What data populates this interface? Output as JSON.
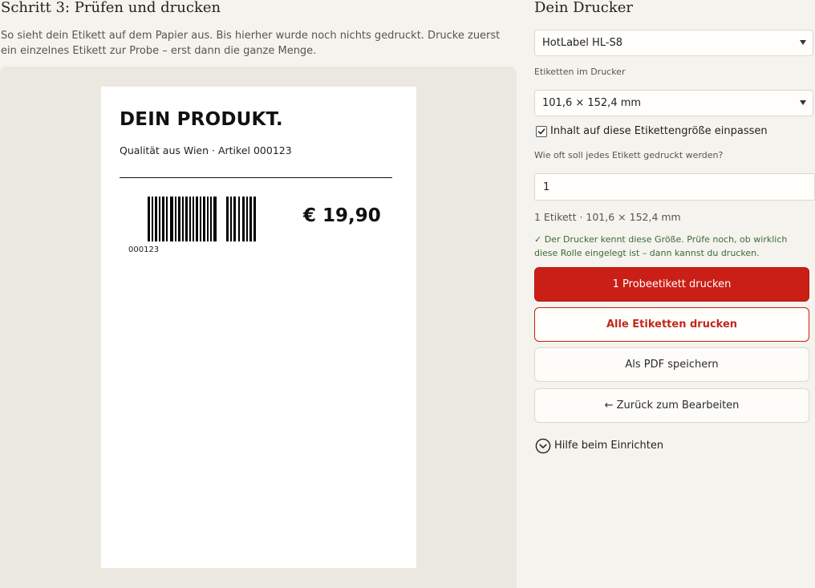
{
  "step": {
    "title": "Schritt 3: Prüfen und drucken",
    "intro": "So sieht dein Etikett auf dem Papier aus. Bis hierher wurde noch nichts gedruckt. Drucke zuerst ein einzelnes Etikett zur Probe – erst dann die ganze Menge."
  },
  "label": {
    "product_name": "DEIN PRODUKT.",
    "subtitle": "Qualität aus Wien · Artikel 000123",
    "barcode_number": "000123",
    "price": "€ 19,90"
  },
  "panel": {
    "title": "Dein Drucker",
    "printer_select": {
      "value": "HotLabel HL-S8"
    },
    "labels_in_printer": {
      "label": "Etiketten im Drucker",
      "value": "101,6 × 152,4 mm"
    },
    "fit_checkbox": {
      "label": "Inhalt auf diese Etikettengröße einpassen",
      "checked": true
    },
    "copies": {
      "label": "Wie oft soll jedes Etikett gedruckt werden?",
      "value": "1"
    },
    "summary": "1 Etikett · 101,6 × 152,4 mm",
    "hint": "✓ Der Drucker kennt diese Größe. Prüfe noch, ob wirklich diese Rolle eingelegt ist – dann kannst du drucken.",
    "buttons": {
      "test_print": "1 Probeetikett drucken",
      "print_all": "Alle Etiketten drucken",
      "save_pdf": "Als PDF speichern",
      "back": "← Zurück zum Bearbeiten"
    },
    "help": {
      "label": "Hilfe beim Einrichten",
      "icon": "chevron-down-circle-icon"
    }
  },
  "colors": {
    "accent": "#c91f16",
    "hint_green": "#3c6b3a",
    "background": "#f5f3ee",
    "preview_background": "#ebe8e0"
  }
}
